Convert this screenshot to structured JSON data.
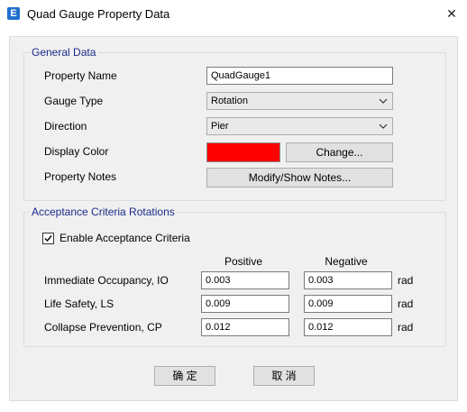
{
  "window": {
    "title": "Quad Gauge Property Data",
    "app_icon_letter": "E",
    "close_glyph": "✕"
  },
  "general": {
    "legend": "General Data",
    "property_name_label": "Property Name",
    "property_name_value": "QuadGauge1",
    "gauge_type_label": "Gauge Type",
    "gauge_type_value": "Rotation",
    "direction_label": "Direction",
    "direction_value": "Pier",
    "display_color_label": "Display Color",
    "display_color": "#ff0000",
    "change_button": "Change...",
    "property_notes_label": "Property Notes",
    "notes_button": "Modify/Show Notes..."
  },
  "acceptance": {
    "legend": "Acceptance Criteria Rotations",
    "enable_label": "Enable Acceptance Criteria",
    "enable_checked": true,
    "positive_header": "Positive",
    "negative_header": "Negative",
    "rows": [
      {
        "label": "Immediate Occupancy, IO",
        "positive": "0.003",
        "negative": "0.003",
        "unit": "rad"
      },
      {
        "label": "Life Safety, LS",
        "positive": "0.009",
        "negative": "0.009",
        "unit": "rad"
      },
      {
        "label": "Collapse Prevention, CP",
        "positive": "0.012",
        "negative": "0.012",
        "unit": "rad"
      }
    ]
  },
  "buttons": {
    "ok": "确 定",
    "cancel": "取 消"
  }
}
